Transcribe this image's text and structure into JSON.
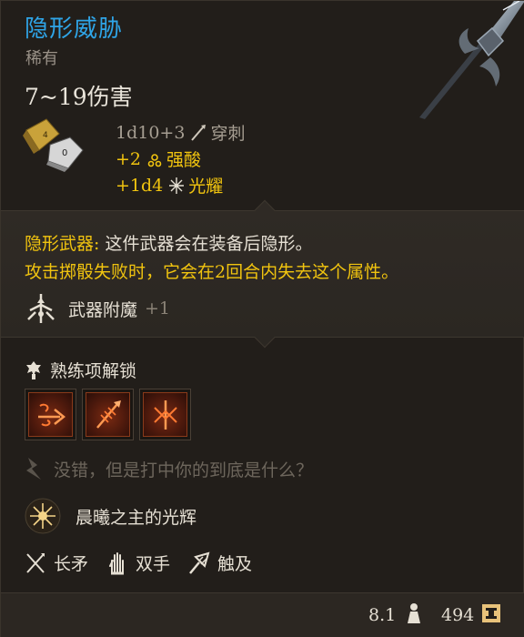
{
  "item": {
    "name": "隐形威胁",
    "rarity": "稀有",
    "damage_range": "7~19伤害",
    "colors": {
      "name": "#2fa5e8",
      "bonus": "#f1c40f"
    }
  },
  "damage_lines": [
    {
      "dice": "1d10+3",
      "type": "穿刺",
      "icon": "piercing-icon",
      "style": "gray"
    },
    {
      "dice": "+2",
      "type": "强酸",
      "icon": "acid-icon",
      "style": "gold"
    },
    {
      "dice": "+1d4",
      "type": "光耀",
      "icon": "radiant-icon",
      "style": "gold"
    }
  ],
  "description": {
    "keyword": "隐形武器:",
    "line1_rest": " 这件武器会在装备后隐形。",
    "line2": "攻击掷骰失败时，它会在2回合内失去这个属性。"
  },
  "enchantment": {
    "label": "武器附魔",
    "value": "+1"
  },
  "proficiency": {
    "title": "熟练项解锁",
    "actions": [
      "action-1-icon",
      "action-2-icon",
      "action-3-icon"
    ]
  },
  "flavor": "没错，但是打中你的到底是什么？",
  "special": "晨曦之主的光辉",
  "properties": [
    {
      "label": "长矛",
      "icon": "spear-type-icon"
    },
    {
      "label": "双手",
      "icon": "two-handed-icon"
    },
    {
      "label": "触及",
      "icon": "reach-icon"
    }
  ],
  "footer": {
    "weight": "8.1",
    "value": "494"
  }
}
